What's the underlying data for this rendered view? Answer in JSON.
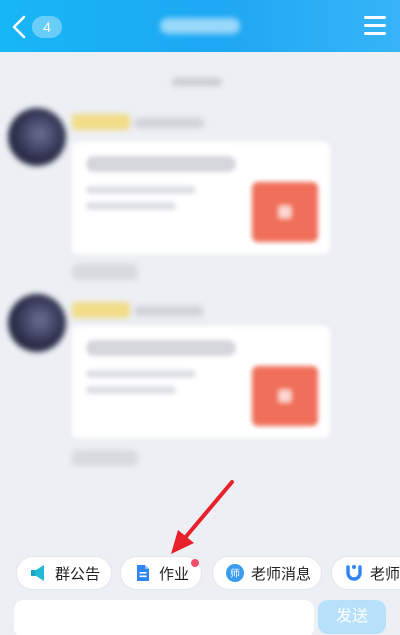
{
  "header": {
    "back_badge": "4",
    "menu_icon": "hamburger-menu-icon"
  },
  "chips": [
    {
      "label": "群公告",
      "icon": "megaphone-icon",
      "color": "#22b8d8"
    },
    {
      "label": "作业",
      "icon": "document-icon",
      "color": "#2f86f3",
      "has_dot": true
    },
    {
      "label": "老师消息",
      "icon": "teacher-icon",
      "color": "#3a9cf0"
    },
    {
      "label": "老师",
      "icon": "magnet-icon",
      "color": "#2f86f3"
    }
  ],
  "input": {
    "placeholder": "",
    "send_label": "发送"
  },
  "colors": {
    "header": "#1ea7f3",
    "accent_red": "#f0506e",
    "annotation_arrow": "#e8202a"
  }
}
